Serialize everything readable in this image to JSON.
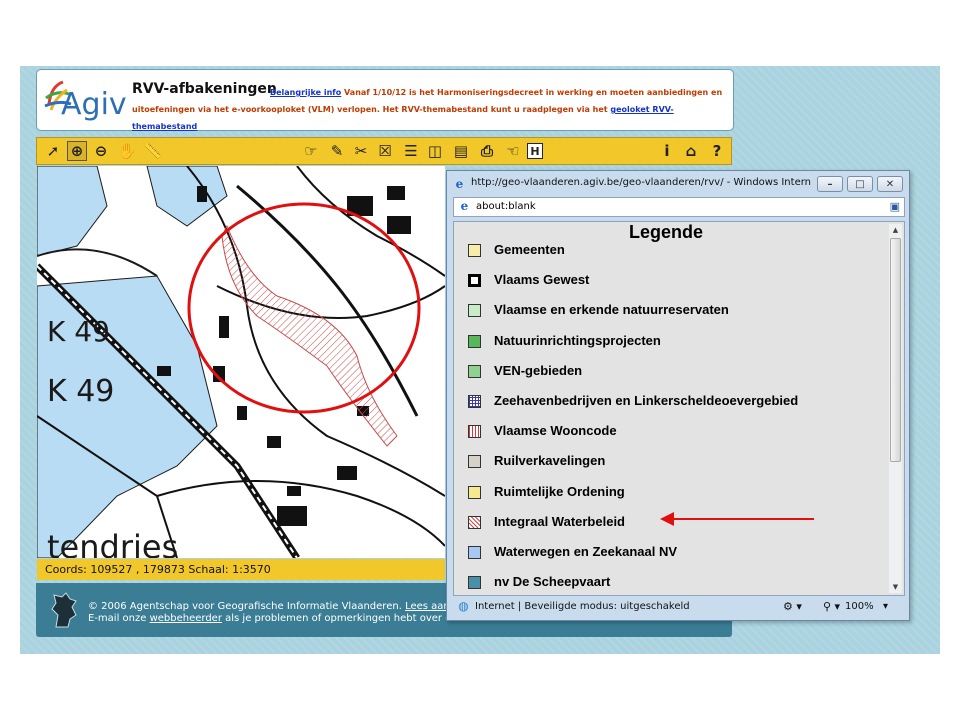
{
  "header": {
    "logo_text": "Agiv",
    "site_title": "RVV-afbakeningen",
    "important_link": "Belangrijke info",
    "notice_line1": "Vanaf 1/10/12 is het Harmoniseringsdecreet in werking en moeten aanbiedingen en",
    "notice_line2": "uitoefeningen via het e-voorkooploket (VLM) verlopen. Het RVV-themabestand kunt u raadplegen via het",
    "geoloket_link": "geoloket RVV-themabestand"
  },
  "toolbar": {
    "left_tools": [
      "select-arrow-icon",
      "zoom-in-icon",
      "zoom-out-icon",
      "pan-hand-icon",
      "measure-ruler-icon"
    ],
    "right_tools": [
      "identify-hand-icon",
      "pencil-icon",
      "tools-cross-icon",
      "clear-icon",
      "list-icon",
      "layers-icon",
      "print-layout-icon",
      "print-icon",
      "info-hand-icon",
      "h-icon"
    ],
    "help_labels": [
      "i",
      "⌂",
      "?"
    ]
  },
  "map": {
    "labels": [
      "K 49",
      "K 49",
      "tendries"
    ]
  },
  "coords": {
    "text": "Coords: 109527 , 179873 Schaal: 1:3570"
  },
  "footer": {
    "line1_prefix": "© 2006 Agentschap voor Geografische Informatie Vlaanderen.",
    "line1_link": "Lees aandac",
    "line2_prefix": "E-mail onze",
    "line2_link": "webbeheerder",
    "line2_suffix": "als je problemen of opmerkingen hebt over deze website."
  },
  "popup": {
    "title": "http://geo-vlaanderen.agiv.be/geo-vlaanderen/rvv/ - Windows Internet E...",
    "address": "about:blank",
    "legend_title": "Legende",
    "legend_items": [
      {
        "label": "Gemeenten",
        "color": "#f7eca8",
        "pattern": "fill"
      },
      {
        "label": "Vlaams Gewest",
        "color": "#ffffff",
        "pattern": "thick-border"
      },
      {
        "label": "Vlaamse en erkende natuurreservaten",
        "color": "#c8ecc8",
        "pattern": "fill"
      },
      {
        "label": "Natuurinrichtingsprojecten",
        "color": "#57b85a",
        "pattern": "fill"
      },
      {
        "label": "VEN-gebieden",
        "color": "#8fd18f",
        "pattern": "fill"
      },
      {
        "label": "Zeehavenbedrijven en Linkerscheldeoevergebied",
        "color": "#3a3aa8",
        "pattern": "grid"
      },
      {
        "label": "Vlaamse Wooncode",
        "color": "#d33a3a",
        "pattern": "vlines"
      },
      {
        "label": "Ruilverkavelingen",
        "color": "#d7d2c8",
        "pattern": "fill"
      },
      {
        "label": "Ruimtelijke Ordening",
        "color": "#f5e88e",
        "pattern": "fill"
      },
      {
        "label": "Integraal Waterbeleid",
        "color": "#c84a4a",
        "pattern": "hatch"
      },
      {
        "label": "Waterwegen en Zeekanaal NV",
        "color": "#a6c8f2",
        "pattern": "fill"
      },
      {
        "label": "nv De Scheepvaart",
        "color": "#4a8fa8",
        "pattern": "fill"
      }
    ],
    "status_text": "Internet | Beveiligde modus: uitgeschakeld",
    "zoom": "100%"
  },
  "colors": {
    "toolbar": "#f2c72a",
    "background": "#a9d3df",
    "water": "#b9dcf5",
    "annotation_red": "#e01010"
  }
}
